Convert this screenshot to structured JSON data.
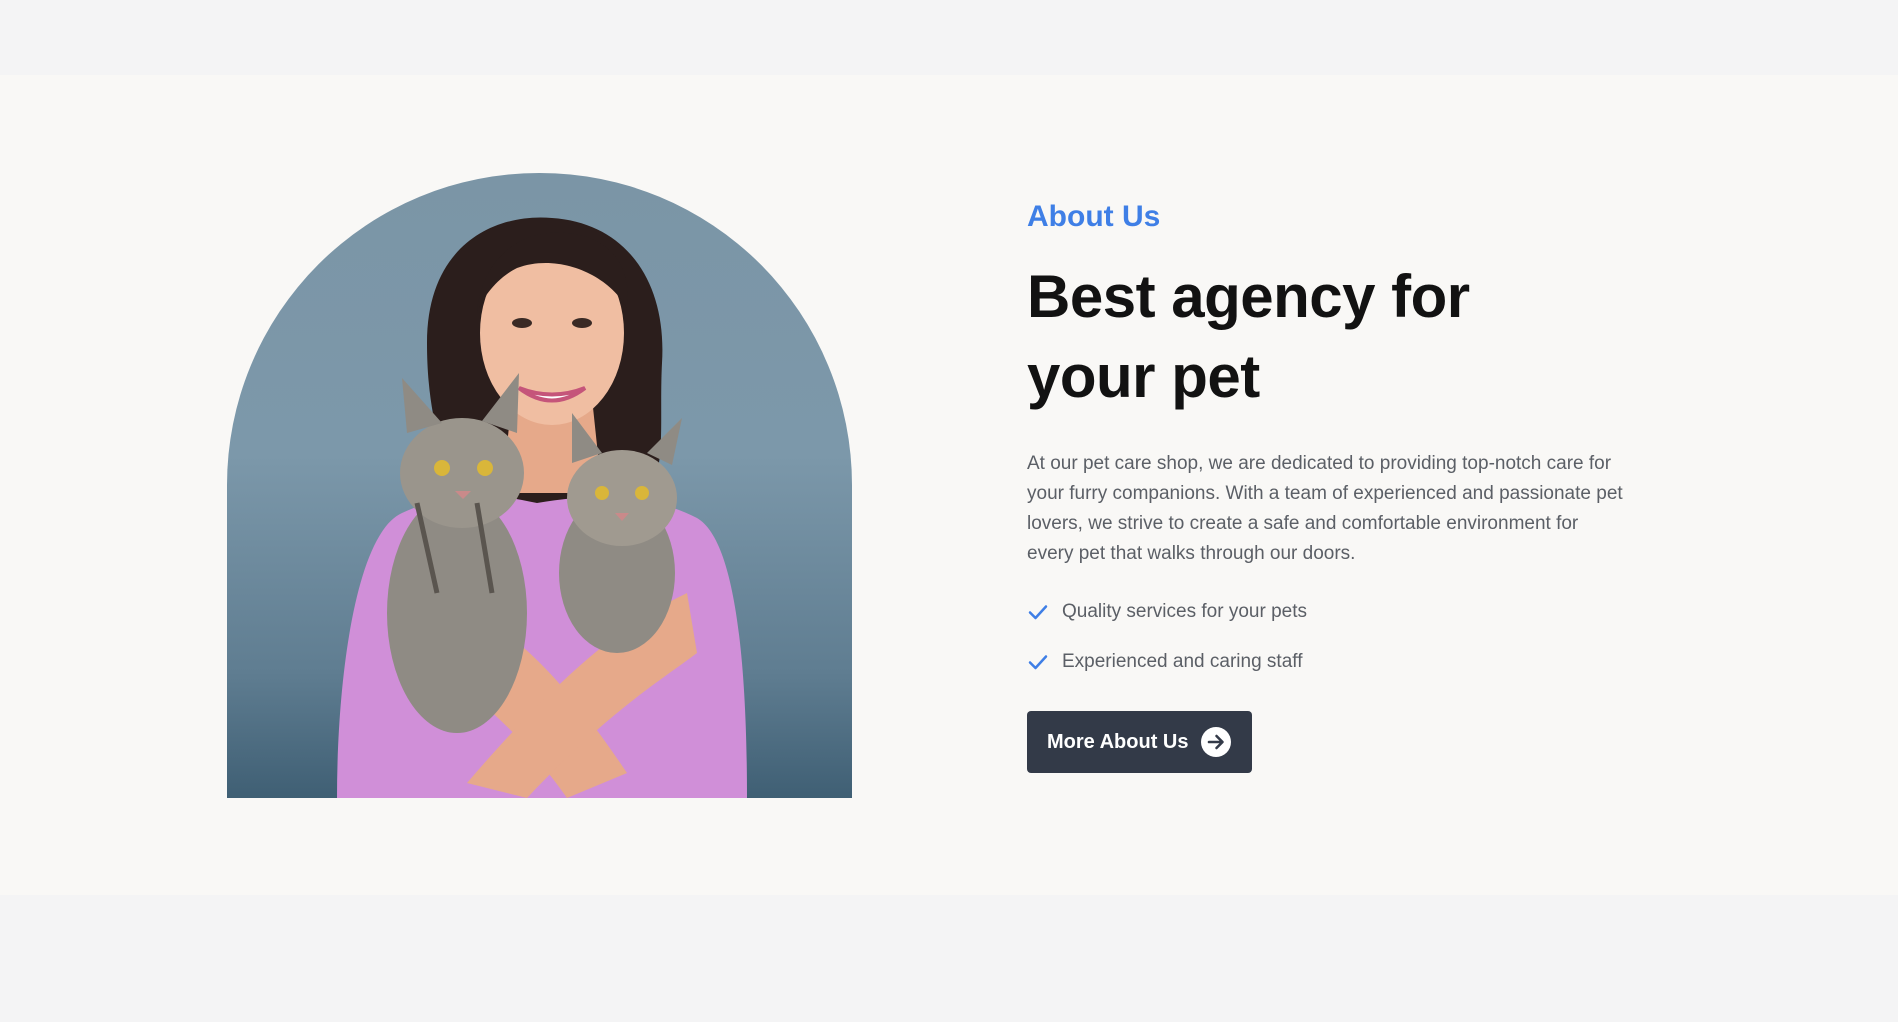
{
  "about": {
    "eyebrow": "About Us",
    "heading": "Best agency for your pet",
    "description": "At our pet care shop, we are dedicated to providing top-notch care for your furry companions. With a team of experienced and passionate pet lovers, we strive to create a safe and comfortable environment for every pet that walks through our doors.",
    "features": [
      {
        "label": "Quality services for your pets",
        "icon": "check-icon"
      },
      {
        "label": "Experienced and caring staff",
        "icon": "check-icon"
      }
    ],
    "button": {
      "label": "More About Us",
      "icon": "arrow-right-circle-icon"
    }
  },
  "colors": {
    "accent": "#3f7fe6",
    "button_bg": "#333a48",
    "section_bg": "#f9f8f6",
    "page_bg": "#f4f4f5"
  }
}
